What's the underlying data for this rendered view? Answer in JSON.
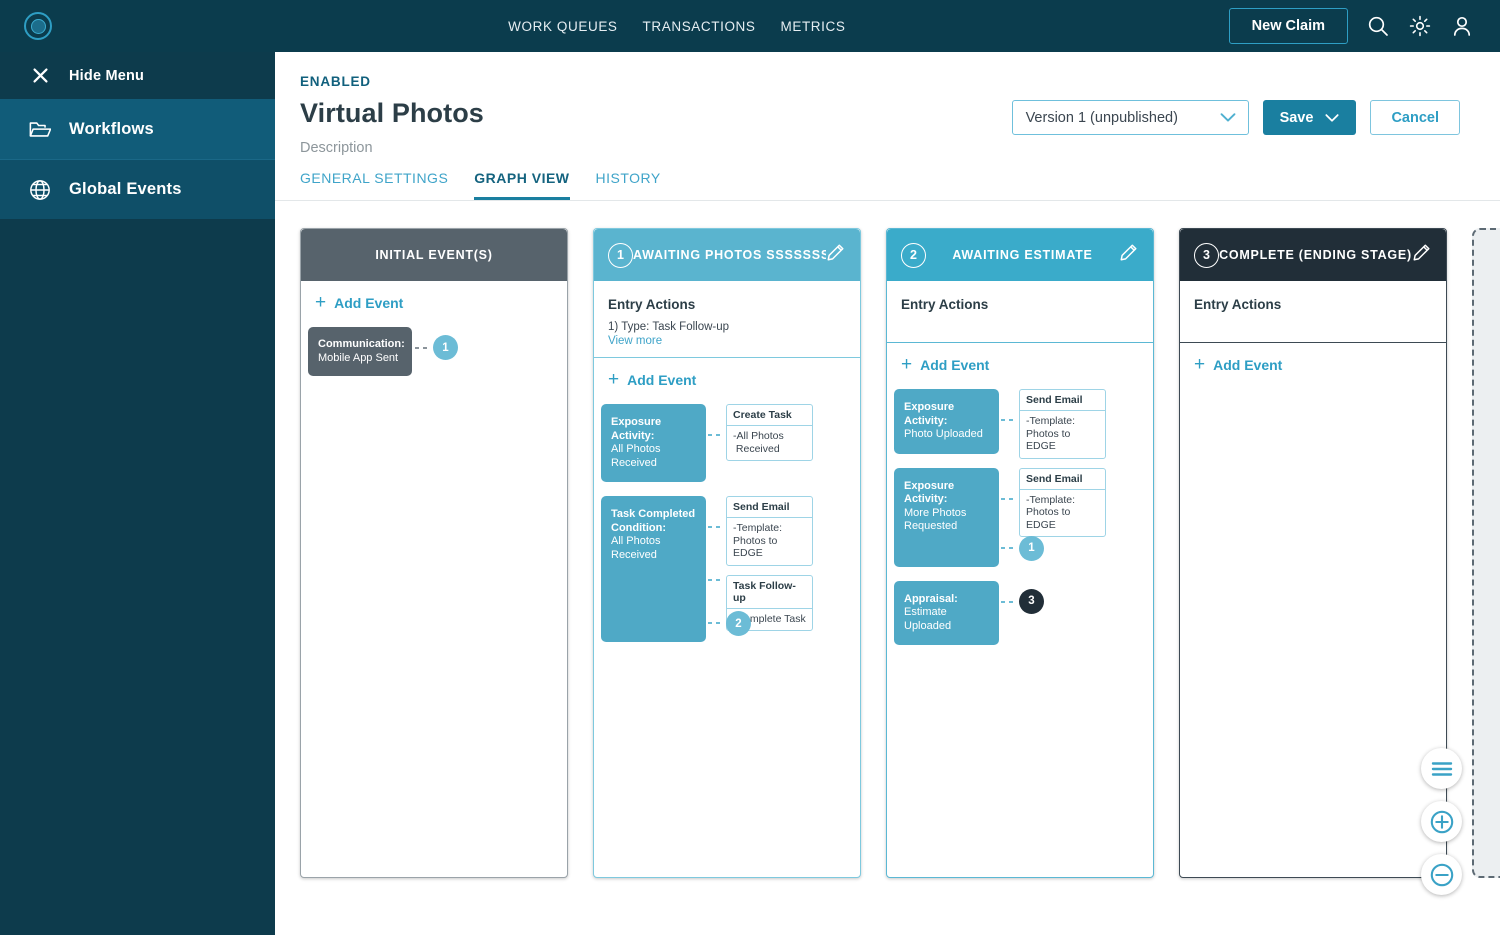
{
  "topbar": {
    "logo_icon": "aperture-logo-icon",
    "nav": [
      {
        "label": "WORK QUEUES"
      },
      {
        "label": "TRANSACTIONS"
      },
      {
        "label": "METRICS"
      }
    ],
    "new_claim_label": "New Claim",
    "search_icon": "search-icon",
    "settings_icon": "gear-icon",
    "account_icon": "user-icon"
  },
  "sidebar": {
    "hide_menu_label": "Hide Menu",
    "items": [
      {
        "label": "Workflows",
        "icon": "folder-icon"
      },
      {
        "label": "Global Events",
        "icon": "globe-icon"
      }
    ]
  },
  "header": {
    "status": "ENABLED",
    "title": "Virtual Photos",
    "description": "Description",
    "version_value": "Version 1 (unpublished)",
    "save_label": "Save",
    "cancel_label": "Cancel"
  },
  "tabs": [
    {
      "label": "GENERAL SETTINGS",
      "active": false
    },
    {
      "label": "GRAPH VIEW",
      "active": true
    },
    {
      "label": "HISTORY",
      "active": false
    }
  ],
  "labels": {
    "add_event": "Add Event",
    "entry_actions": "Entry Actions",
    "view_more": "View more"
  },
  "colors": {
    "brand_dark": "#0b3c4d",
    "accent": "#2e9ec4",
    "stage_blue": "#5ab4cf",
    "stage_gray": "#57636c",
    "stage_dark": "#212e38"
  },
  "stages": [
    {
      "number": "",
      "title": "INITIAL EVENT(S)",
      "head_color": "#57636c",
      "border_color": "#9aa3a9",
      "entry_actions": null,
      "events": [
        {
          "title": "Communication:",
          "subtitle": "Mobile App Sent",
          "style": "dark",
          "subcards": [],
          "badge": {
            "text": "1",
            "style": "light"
          }
        }
      ]
    },
    {
      "number": "1",
      "title": "AWAITING PHOTOS SSSSSSSS",
      "head_color": "#5ab4cf",
      "border_color": "#7ec9de",
      "entry_actions": {
        "line": "1) Type: Task Follow-up",
        "view_more": true
      },
      "events": [
        {
          "title": "Exposure Activity:",
          "subtitle": "All Photos Received",
          "style": "blue",
          "subcards": [
            {
              "header": "Create Task",
              "body": "-All Photos\n Received"
            }
          ],
          "badge": null
        },
        {
          "title": "Task Completed Condition:",
          "subtitle": "All Photos Received",
          "style": "blue",
          "subcards": [
            {
              "header": "Send Email",
              "body": "-Template:\nPhotos to EDGE"
            },
            {
              "header": "Task Follow-up",
              "body": "-Complete Task"
            }
          ],
          "badge": {
            "text": "2",
            "style": "light"
          }
        }
      ]
    },
    {
      "number": "2",
      "title": "AWAITING ESTIMATE",
      "head_color": "#3aabca",
      "border_color": "#5bb8d4",
      "entry_actions": {
        "line": "",
        "view_more": false
      },
      "events": [
        {
          "title": "Exposure Activity:",
          "subtitle": "Photo Uploaded",
          "style": "blue",
          "subcards": [
            {
              "header": "Send Email",
              "body": "-Template:\nPhotos to EDGE"
            }
          ],
          "badge": null
        },
        {
          "title": "Exposure Activity:",
          "subtitle": "More Photos Requested",
          "style": "blue",
          "subcards": [
            {
              "header": "Send Email",
              "body": "-Template:\nPhotos to EDGE"
            }
          ],
          "badge": {
            "text": "1",
            "style": "light"
          }
        },
        {
          "title": "Appraisal:",
          "subtitle": "Estimate Uploaded",
          "style": "blue",
          "subcards": [],
          "badge": {
            "text": "3",
            "style": "dark"
          }
        }
      ]
    },
    {
      "number": "3",
      "title": "COMPLETE (ENDING STAGE)",
      "head_color": "#212e38",
      "border_color": "#3d4a54",
      "entry_actions": {
        "line": "",
        "view_more": false
      },
      "events": []
    }
  ],
  "fabs": [
    {
      "icon": "menu-icon",
      "name": "layout-menu-button"
    },
    {
      "icon": "zoom-in-icon",
      "name": "zoom-in-button"
    },
    {
      "icon": "zoom-out-icon",
      "name": "zoom-out-button"
    }
  ]
}
